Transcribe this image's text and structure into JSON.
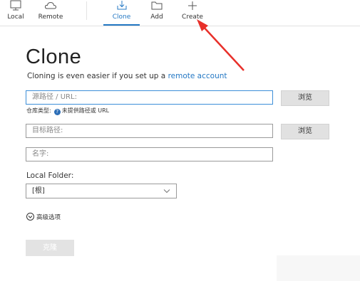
{
  "toolbar": {
    "items": [
      {
        "label": "Local",
        "icon": "monitor-icon",
        "active": false
      },
      {
        "label": "Remote",
        "icon": "cloud-icon",
        "active": false
      },
      {
        "label": "Clone",
        "icon": "download-tray-icon",
        "active": true
      },
      {
        "label": "Add",
        "icon": "folder-icon",
        "active": false
      },
      {
        "label": "Create",
        "icon": "plus-icon",
        "active": false
      }
    ]
  },
  "page": {
    "title": "Clone",
    "subtitle_text": "Cloning is even easier if you set up a",
    "subtitle_link": "remote account"
  },
  "form": {
    "source_placeholder": "源路径 / URL:",
    "browse1": "浏览",
    "repo_type_label": "仓库类型:",
    "repo_type_value": "未提供路径或 URL",
    "target_placeholder": "目标路径:",
    "browse2": "浏览",
    "name_placeholder": "名字:",
    "local_folder_label": "Local Folder:",
    "local_folder_value": "[根]",
    "advanced_label": "高级选项",
    "clone_button": "克隆"
  },
  "colors": {
    "accent": "#2478c4",
    "arrow": "#e8302a",
    "disabled_button": "#e3e3e3"
  }
}
